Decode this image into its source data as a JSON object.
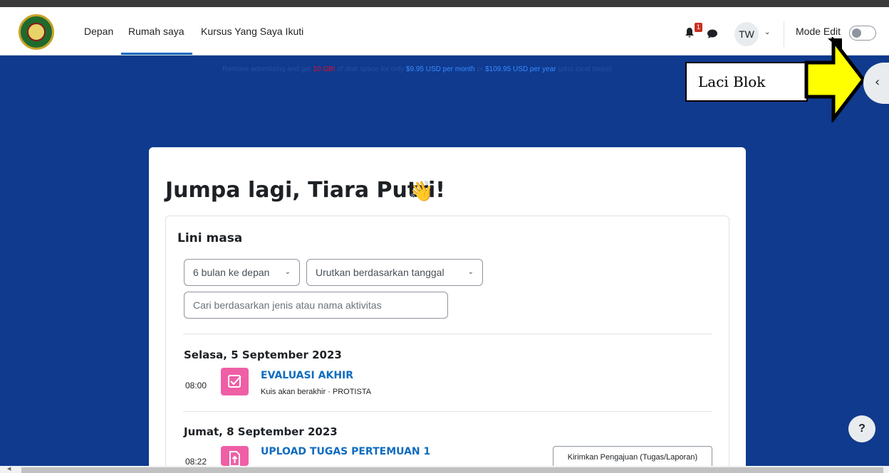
{
  "navbar": {
    "links": [
      "Depan",
      "Rumah saya",
      "Kursus Yang Saya Ikuti"
    ],
    "notification_count": "1",
    "avatar_initials": "TW",
    "mode_edit_label": "Mode Edit"
  },
  "ad": {
    "part1": "Remove advertising and get ",
    "highlight": "10 GB!",
    "part2": " of disk space for only ",
    "price_month": "$9.95 USD per month",
    "part3": " or ",
    "price_year": "$109.95 USD per year",
    "part4": " (plus local taxes)"
  },
  "annotation": {
    "label": "Laci Blok"
  },
  "main": {
    "greeting": "Jumpa lagi, Tiara Putri!",
    "wave_emoji": "👋"
  },
  "timeline": {
    "title": "Lini masa",
    "filter_range": "6 bulan ke depan",
    "sort_label": "Urutkan berdasarkan tanggal",
    "search_placeholder": "Cari berdasarkan jenis atau nama aktivitas",
    "groups": [
      {
        "date": "Selasa, 5 September 2023",
        "items": [
          {
            "time": "08:00",
            "title": "EVALUASI AKHIR",
            "subtitle": "Kuis akan berakhir · PROTISTA"
          }
        ]
      },
      {
        "date": "Jumat, 8 September 2023",
        "items": [
          {
            "time": "08:22",
            "title": "UPLOAD TUGAS PERTEMUAN 1",
            "action": "Kirimkan Pengajuan (Tugas/Laporan)"
          }
        ]
      }
    ]
  },
  "help_label": "?",
  "colors": {
    "page_bg": "#0f3a8e",
    "accent": "#0f6cbf",
    "activity_icon": "#ee5fa6",
    "annotation_arrow": "#ffff00"
  }
}
